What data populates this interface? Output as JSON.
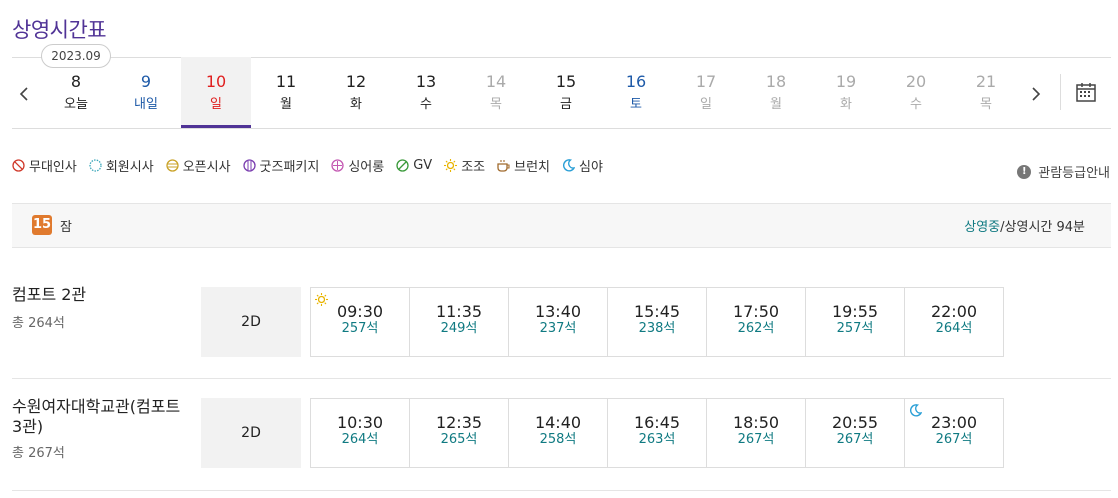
{
  "page": {
    "title": "상영시간표"
  },
  "date_nav": {
    "month": "2023.09",
    "days": [
      {
        "num": "8",
        "dow": "오늘",
        "color": "black",
        "selected": false
      },
      {
        "num": "9",
        "dow": "내일",
        "color": "blue",
        "selected": false
      },
      {
        "num": "10",
        "dow": "일",
        "color": "red",
        "selected": true
      },
      {
        "num": "11",
        "dow": "월",
        "color": "black",
        "selected": false
      },
      {
        "num": "12",
        "dow": "화",
        "color": "black",
        "selected": false
      },
      {
        "num": "13",
        "dow": "수",
        "color": "black",
        "selected": false
      },
      {
        "num": "14",
        "dow": "목",
        "color": "gray",
        "selected": false
      },
      {
        "num": "15",
        "dow": "금",
        "color": "black",
        "selected": false
      },
      {
        "num": "16",
        "dow": "토",
        "color": "blue",
        "selected": false
      },
      {
        "num": "17",
        "dow": "일",
        "color": "gray",
        "selected": false
      },
      {
        "num": "18",
        "dow": "월",
        "color": "gray",
        "selected": false
      },
      {
        "num": "19",
        "dow": "화",
        "color": "gray",
        "selected": false
      },
      {
        "num": "20",
        "dow": "수",
        "color": "gray",
        "selected": false
      },
      {
        "num": "21",
        "dow": "목",
        "color": "gray",
        "selected": false
      }
    ]
  },
  "legend": [
    {
      "label": "무대인사",
      "icon": "stage-greeting-icon",
      "color": "#d0392b"
    },
    {
      "label": "회원시사",
      "icon": "member-preview-icon",
      "color": "#3aa6b9"
    },
    {
      "label": "오픈시사",
      "icon": "open-preview-icon",
      "color": "#c9a227"
    },
    {
      "label": "굿즈패키지",
      "icon": "goods-package-icon",
      "color": "#7b3fb0"
    },
    {
      "label": "싱어롱",
      "icon": "singalong-icon",
      "color": "#c45ab3"
    },
    {
      "label": "GV",
      "icon": "gv-icon",
      "color": "#3a9a3a"
    },
    {
      "label": "조조",
      "icon": "morning-sun-icon",
      "color": "#e8b400"
    },
    {
      "label": "브런치",
      "icon": "brunch-cup-icon",
      "color": "#a06a2c"
    },
    {
      "label": "심야",
      "icon": "late-night-moon-icon",
      "color": "#2a9fd6"
    }
  ],
  "rating_guide": "관람등급안내",
  "movie": {
    "age": "15",
    "status": "잠",
    "now_showing": "상영중",
    "run_time": "/상영시간 94분"
  },
  "halls": [
    {
      "name": "컴포트 2관",
      "seats": "총 264석",
      "format": "2D",
      "slots": [
        {
          "time": "09:30",
          "seats": "257석",
          "mark": "morning"
        },
        {
          "time": "11:35",
          "seats": "249석",
          "mark": ""
        },
        {
          "time": "13:40",
          "seats": "237석",
          "mark": ""
        },
        {
          "time": "15:45",
          "seats": "238석",
          "mark": ""
        },
        {
          "time": "17:50",
          "seats": "262석",
          "mark": ""
        },
        {
          "time": "19:55",
          "seats": "257석",
          "mark": ""
        },
        {
          "time": "22:00",
          "seats": "264석",
          "mark": ""
        }
      ]
    },
    {
      "name": "수원여자대학교관(컴포트 3관)",
      "seats": "총 267석",
      "format": "2D",
      "slots": [
        {
          "time": "10:30",
          "seats": "264석",
          "mark": ""
        },
        {
          "time": "12:35",
          "seats": "265석",
          "mark": ""
        },
        {
          "time": "14:40",
          "seats": "258석",
          "mark": ""
        },
        {
          "time": "16:45",
          "seats": "263석",
          "mark": ""
        },
        {
          "time": "18:50",
          "seats": "267석",
          "mark": ""
        },
        {
          "time": "20:55",
          "seats": "267석",
          "mark": ""
        },
        {
          "time": "23:00",
          "seats": "267석",
          "mark": "night"
        }
      ]
    }
  ]
}
